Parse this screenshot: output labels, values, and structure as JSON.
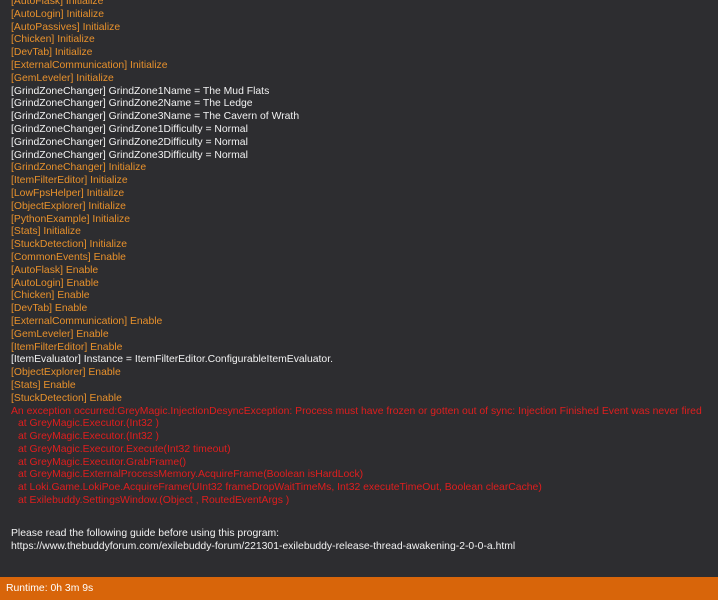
{
  "log_lines": [
    {
      "text": "[AutoFlask] Initialize",
      "color": "orange"
    },
    {
      "text": "[AutoLogin] Initialize",
      "color": "orange"
    },
    {
      "text": "[AutoPassives] Initialize",
      "color": "orange"
    },
    {
      "text": "[Chicken] Initialize",
      "color": "orange"
    },
    {
      "text": "[DevTab] Initialize",
      "color": "orange"
    },
    {
      "text": "[ExternalCommunication] Initialize",
      "color": "orange"
    },
    {
      "text": "[GemLeveler] Initialize",
      "color": "orange"
    },
    {
      "text": "[GrindZoneChanger] GrindZone1Name = The Mud Flats",
      "color": "white"
    },
    {
      "text": "[GrindZoneChanger] GrindZone2Name = The Ledge",
      "color": "white"
    },
    {
      "text": "[GrindZoneChanger] GrindZone3Name = The Cavern of Wrath",
      "color": "white"
    },
    {
      "text": "[GrindZoneChanger] GrindZone1Difficulty = Normal",
      "color": "white"
    },
    {
      "text": "[GrindZoneChanger] GrindZone2Difficulty = Normal",
      "color": "white"
    },
    {
      "text": "[GrindZoneChanger] GrindZone3Difficulty = Normal",
      "color": "white"
    },
    {
      "text": "[GrindZoneChanger] Initialize",
      "color": "orange"
    },
    {
      "text": "[ItemFilterEditor] Initialize",
      "color": "orange"
    },
    {
      "text": "[LowFpsHelper] Initialize",
      "color": "orange"
    },
    {
      "text": "[ObjectExplorer] Initialize",
      "color": "orange"
    },
    {
      "text": "[PythonExample] Initialize",
      "color": "orange"
    },
    {
      "text": "[Stats] Initialize",
      "color": "orange"
    },
    {
      "text": "[StuckDetection] Initialize",
      "color": "orange"
    },
    {
      "text": "[CommonEvents] Enable",
      "color": "orange"
    },
    {
      "text": "[AutoFlask] Enable",
      "color": "orange"
    },
    {
      "text": "[AutoLogin] Enable",
      "color": "orange"
    },
    {
      "text": "[Chicken] Enable",
      "color": "orange"
    },
    {
      "text": "[DevTab] Enable",
      "color": "orange"
    },
    {
      "text": "[ExternalCommunication] Enable",
      "color": "orange"
    },
    {
      "text": "[GemLeveler] Enable",
      "color": "orange"
    },
    {
      "text": "[ItemFilterEditor] Enable",
      "color": "orange"
    },
    {
      "text": "[ItemEvaluator] Instance = ItemFilterEditor.ConfigurableItemEvaluator.",
      "color": "white"
    },
    {
      "text": "[ObjectExplorer] Enable",
      "color": "orange"
    },
    {
      "text": "[Stats] Enable",
      "color": "orange"
    },
    {
      "text": "[StuckDetection] Enable",
      "color": "orange"
    }
  ],
  "exception": {
    "message": "An exception occurred:GreyMagic.InjectionDesyncException: Process must have frozen or gotten out of sync: Injection Finished Event was never fired",
    "stack": [
      "at GreyMagic.Executor.(Int32 )",
      "at GreyMagic.Executor.(Int32 )",
      "at GreyMagic.Executor.Execute(Int32 timeout)",
      "at GreyMagic.Executor.GrabFrame()",
      "at GreyMagic.ExternalProcessMemory.AcquireFrame(Boolean isHardLock)",
      "at Loki.Game.LokiPoe.AcquireFrame(UInt32 frameDropWaitTimeMs, Int32 executeTimeOut, Boolean clearCache)",
      "at Exilebuddy.SettingsWindow.(Object , RoutedEventArgs )"
    ]
  },
  "guide": {
    "message": "Please read the following guide before using this program:",
    "url": "https://www.thebuddyforum.com/exilebuddy-forum/221301-exilebuddy-release-thread-awakening-2-0-0-a.html"
  },
  "status": {
    "runtime_label": "Runtime: 0h 3m 9s"
  },
  "colors": {
    "background": "#2d2d30",
    "orange_text": "#e8912c",
    "white_text": "#f2f2f2",
    "error_text": "#e01e1e",
    "status_bar": "#d8650a"
  }
}
